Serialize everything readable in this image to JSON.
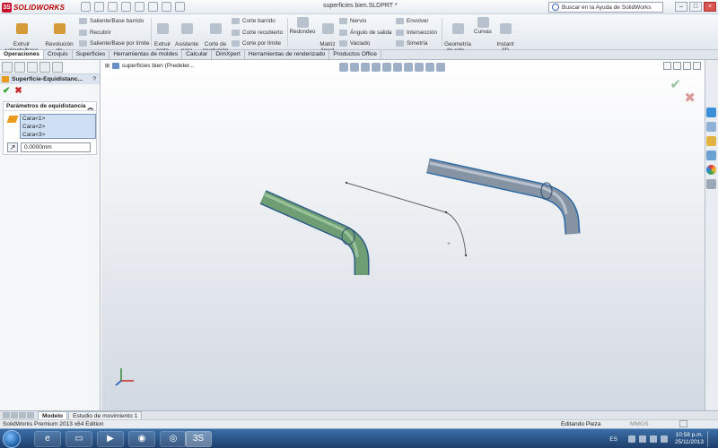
{
  "app": {
    "name": "SOLIDWORKS",
    "document_title": "superficies bien.SLDPRT *"
  },
  "help_search": {
    "placeholder": "Buscar en la Ayuda de SolidWorks"
  },
  "ribbon": {
    "extrude_boss": "Extruir\nsaliente/base",
    "revolve_boss": "Revolución\nde\nsaliente/base",
    "swept_boss": "Saliente/Base barrido",
    "loft_boss": "Recubrir",
    "boundary_boss": "Saliente/Base por límite",
    "extrude_cut": "Extruir\ncorte",
    "hole_wizard": "Asistente\npara\ntaladro",
    "revolve_cut": "Corte de\nrevolución",
    "swept_cut": "Corte barrido",
    "lofted_cut": "Corte recubierto",
    "boundary_cut": "Corte por límite",
    "fillet": "Redondeo",
    "linear_pattern": "Matriz\nlineal",
    "rib": "Nervio",
    "draft": "Ángulo de salida",
    "shell": "Vaciado",
    "wrap": "Envolver",
    "intersect": "Intersección",
    "mirror": "Simetría",
    "reference_geometry": "Geometría\nde refe...",
    "curves": "Curvas",
    "instant3d": "Instant\n3D"
  },
  "command_tabs": [
    "Operaciones",
    "Croquis",
    "Superficies",
    "Herramientas de moldes",
    "Calcular",
    "DimXpert",
    "Herramientas de renderizado",
    "Productos Office"
  ],
  "property_manager": {
    "title": "Superficie-Equidistanc...",
    "help": "?",
    "ok_symbol": "✔",
    "cancel_symbol": "✖",
    "group_title": "Parámetros de equidistancia",
    "faces": [
      "Cara<1>",
      "Cara<2>",
      "Cara<3>"
    ],
    "distance_value": "0.0000mm"
  },
  "viewport": {
    "tree_flyout": "superficies bien  (Predeter..."
  },
  "bottom_tabs": [
    "Modelo",
    "Estudio de movimiento 1"
  ],
  "status": {
    "edition": "SolidWorks Premium 2013 x64 Edition",
    "mode": "Editando Pieza",
    "units": "MMGS"
  },
  "taskbar": {
    "language": "ES",
    "time": "10:58 p.m.",
    "date": "25/11/2013"
  },
  "colors": {
    "brand_red": "#c8102e",
    "selection_face": "#cfe0f4",
    "ok_green": "#2e9d2e",
    "cancel_red": "#c62828"
  }
}
